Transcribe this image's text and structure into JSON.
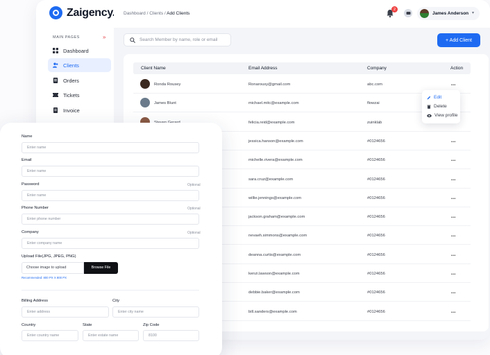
{
  "brand": {
    "name": "Zaigency."
  },
  "sidebar": {
    "section_label": "MAIN PAGES",
    "items": [
      {
        "label": "Dashboard",
        "icon": "grid-icon"
      },
      {
        "label": "Clients",
        "icon": "users-icon",
        "active": true
      },
      {
        "label": "Orders",
        "icon": "orders-icon"
      },
      {
        "label": "Tickets",
        "icon": "ticket-icon"
      },
      {
        "label": "Invoice",
        "icon": "invoice-icon"
      }
    ]
  },
  "header": {
    "breadcrumb_prefix": "Dashboard / Clients / ",
    "breadcrumb_current": "Add Clients",
    "notification_count": "2",
    "user_name": "James Anderson"
  },
  "toolbar": {
    "search_placeholder": "Search Member by name, role or email",
    "add_button": "+ Add Client"
  },
  "table": {
    "columns": [
      "Client Name",
      "Email Address",
      "Company",
      "Action"
    ],
    "rows": [
      {
        "name": "Ronda Rousey",
        "email": "Ronarousy@gmail.com",
        "company": "abc.com"
      },
      {
        "name": "James Blunt",
        "email": "michael.mitc@example.com",
        "company": "flowzai"
      },
      {
        "name": "Steven Gerard",
        "email": "felicia.reid@example.com",
        "company": "zuinklab"
      },
      {
        "name": "",
        "email": "jessica.hanson@example.com",
        "company": "#0124656"
      },
      {
        "name": "",
        "email": "michelle.rivera@example.com",
        "company": "#0124656"
      },
      {
        "name": "",
        "email": "sara.cruz@example.com",
        "company": "#0124656"
      },
      {
        "name": "",
        "email": "willie.jennings@example.com",
        "company": "#0124656"
      },
      {
        "name": "",
        "email": "jackson.graham@example.com",
        "company": "#0124656"
      },
      {
        "name": "",
        "email": "nevaeh.simmons@example.com",
        "company": "#0124656"
      },
      {
        "name": "",
        "email": "deanna.curtis@example.com",
        "company": "#0124656"
      },
      {
        "name": "",
        "email": "kenzi.lawson@example.com",
        "company": "#0124656"
      },
      {
        "name": "",
        "email": "debbie.baker@example.com",
        "company": "#0124656"
      },
      {
        "name": "",
        "email": "bill.sanders@example.com",
        "company": "#0124656"
      }
    ]
  },
  "action_menu": {
    "edit": "Edit",
    "delete": "Delete",
    "view": "View profile"
  },
  "form": {
    "name_label": "Name",
    "name_placeholder": "Enter name",
    "email_label": "Email",
    "email_placeholder": "Enter name",
    "password_label": "Password",
    "password_optional": "Optional",
    "password_placeholder": "Enter name",
    "phone_label": "Phone Number",
    "phone_optional": "Optional",
    "phone_placeholder": "Enter phone number",
    "company_label": "Company",
    "company_optional": "Optional",
    "company_placeholder": "Enter company name",
    "upload_label": "Upload File(JPG, JPEG, PNG)",
    "upload_placeholder": "Choose image to upload",
    "browse_button": "Browse File",
    "upload_hint": "Recommended: 800 PX X 800 PX",
    "billing_label": "Billing Address",
    "billing_placeholder": "Enter address",
    "city_label": "City",
    "city_placeholder": "Enter city name",
    "country_label": "Country",
    "country_placeholder": "Enter country name",
    "state_label": "State",
    "state_placeholder": "Enter estate name",
    "zip_label": "Zip Code",
    "zip_value": "8100"
  },
  "colors": {
    "accent": "#1e6bf2",
    "badge": "#ef4444"
  }
}
